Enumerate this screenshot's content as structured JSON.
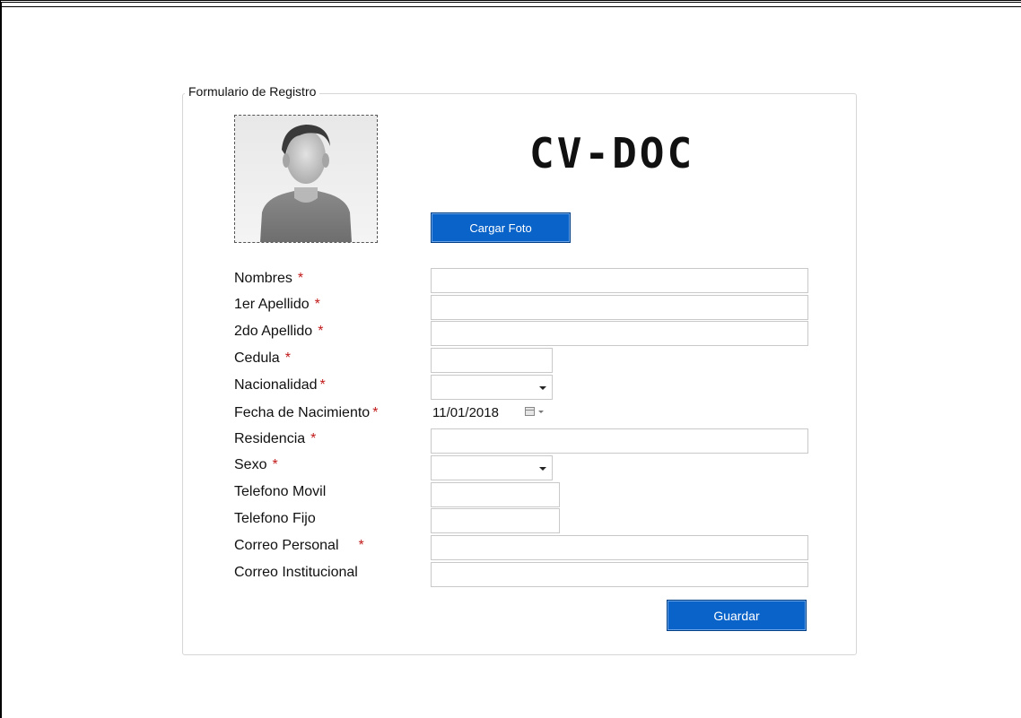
{
  "form": {
    "title": "Formulario de Registro",
    "logo": "CV-DOC",
    "upload_button": "Cargar Foto",
    "save_button": "Guardar",
    "required_marker": "*",
    "fields": [
      {
        "label": "Nombres",
        "required": true,
        "value": ""
      },
      {
        "label": "1er Apellido",
        "required": true,
        "value": ""
      },
      {
        "label": "2do Apellido",
        "required": true,
        "value": ""
      },
      {
        "label": "Cedula",
        "required": true,
        "value": ""
      },
      {
        "label": "Nacionalidad",
        "required": true,
        "value": ""
      },
      {
        "label": "Fecha de Nacimiento",
        "required": true,
        "value": "11/01/2018"
      },
      {
        "label": "Residencia",
        "required": true,
        "value": ""
      },
      {
        "label": "Sexo",
        "required": true,
        "value": ""
      },
      {
        "label": "Telefono Movil",
        "required": false,
        "value": ""
      },
      {
        "label": "Telefono Fijo",
        "required": false,
        "value": ""
      },
      {
        "label": "Correo Personal",
        "required": true,
        "value": ""
      },
      {
        "label": "Correo Institucional",
        "required": false,
        "value": ""
      }
    ]
  },
  "colors": {
    "button_blue": "#0a63c9",
    "required_red": "#c21a1a",
    "input_border": "#c9c9c9"
  },
  "icons": {
    "photo": "user-silhouette-icon",
    "calendar": "calendar-icon",
    "dropdown": "chevron-down-icon"
  }
}
